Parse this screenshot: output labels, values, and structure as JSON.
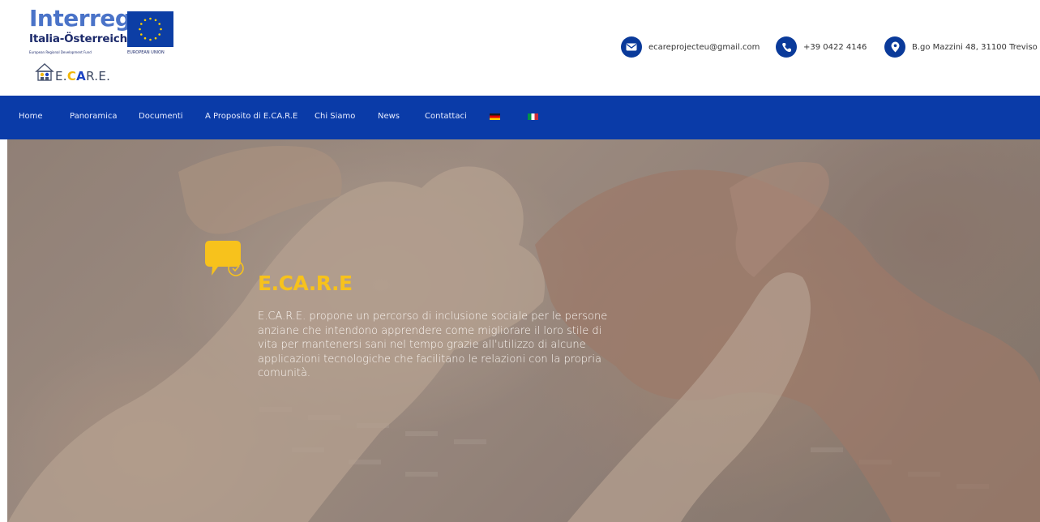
{
  "header": {
    "interreg": {
      "word": "Interreg",
      "subtitle": "Italia-Österreich",
      "fund": "European Regional Development Fund",
      "eu_label": "EUROPEAN UNION"
    },
    "ecare_logo": {
      "part1": "E.",
      "part2": "C",
      "part3": "A",
      "part4": "R.E."
    },
    "contacts": {
      "email": "ecareprojecteu@gmail.com",
      "phone": "+39 0422 4146",
      "address": "B.go Mazzini 48, 31100 Treviso"
    }
  },
  "nav": {
    "items": [
      "Home",
      "Panoramica",
      "Documenti",
      "A Proposito di E.CA.R.E",
      "Chi Siamo",
      "News",
      "Contattaci"
    ],
    "flags": [
      "de-flag-icon",
      "it-flag-icon"
    ]
  },
  "hero": {
    "title": "E.CA.R.E",
    "description": "E.CA.R.E. propone un percorso di inclusione sociale per le persone anziane che intendono apprendere come migliorare il loro stile di vita per mantenersi sani nel tempo grazie all'utilizzo di alcune applicazioni tecnologiche che facilitano le relazioni con la propria comunità."
  },
  "colors": {
    "nav_bg": "#0a3ba8",
    "accent_yellow": "#f7c21c",
    "icon_blue": "#0a3a9a"
  }
}
